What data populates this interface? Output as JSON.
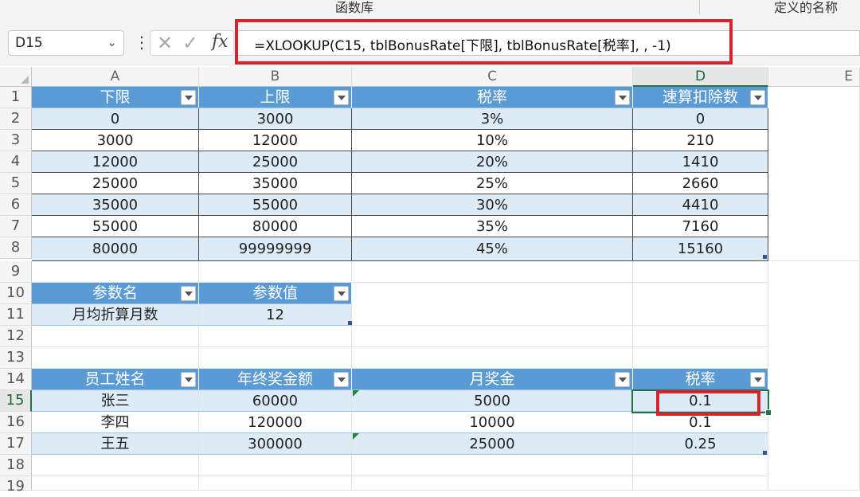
{
  "ribbon": {
    "group_functions": "函数库",
    "group_names": "定义的名称"
  },
  "formula_bar": {
    "name_box": "D15",
    "name_box_arrow": "⌄",
    "more": "⋮",
    "cancel": "✕",
    "enter": "✓",
    "fx": "fx",
    "formula": "=XLOOKUP(C15, tblBonusRate[下限], tblBonusRate[税率], , -1)"
  },
  "columns": [
    "A",
    "B",
    "C",
    "D",
    "E"
  ],
  "rows": [
    "1",
    "2",
    "3",
    "4",
    "5",
    "6",
    "7",
    "8",
    "9",
    "10",
    "11",
    "12",
    "13",
    "14",
    "15",
    "16",
    "17",
    "18",
    "19"
  ],
  "rate_table": {
    "headers": [
      "下限",
      "上限",
      "税率",
      "速算扣除数"
    ],
    "rows": [
      [
        "0",
        "3000",
        "3%",
        "0"
      ],
      [
        "3000",
        "12000",
        "10%",
        "210"
      ],
      [
        "12000",
        "25000",
        "20%",
        "1410"
      ],
      [
        "25000",
        "35000",
        "25%",
        "2660"
      ],
      [
        "35000",
        "55000",
        "30%",
        "4410"
      ],
      [
        "55000",
        "80000",
        "35%",
        "7160"
      ],
      [
        "80000",
        "99999999",
        "45%",
        "15160"
      ]
    ]
  },
  "param_table": {
    "headers": [
      "参数名",
      "参数值"
    ],
    "rows": [
      [
        "月均折算月数",
        "12"
      ]
    ]
  },
  "employee_table": {
    "headers": [
      "员工姓名",
      "年终奖金额",
      "月奖金",
      "税率"
    ],
    "rows": [
      [
        "张三",
        "60000",
        "5000",
        "0.1"
      ],
      [
        "李四",
        "120000",
        "10000",
        "0.1"
      ],
      [
        "王五",
        "300000",
        "25000",
        "0.25"
      ]
    ]
  },
  "active_cell": "D15",
  "colors": {
    "header_fill": "#5b9bd5",
    "band_fill": "#ddebf7",
    "highlight": "#d9232b",
    "selection": "#217346"
  }
}
